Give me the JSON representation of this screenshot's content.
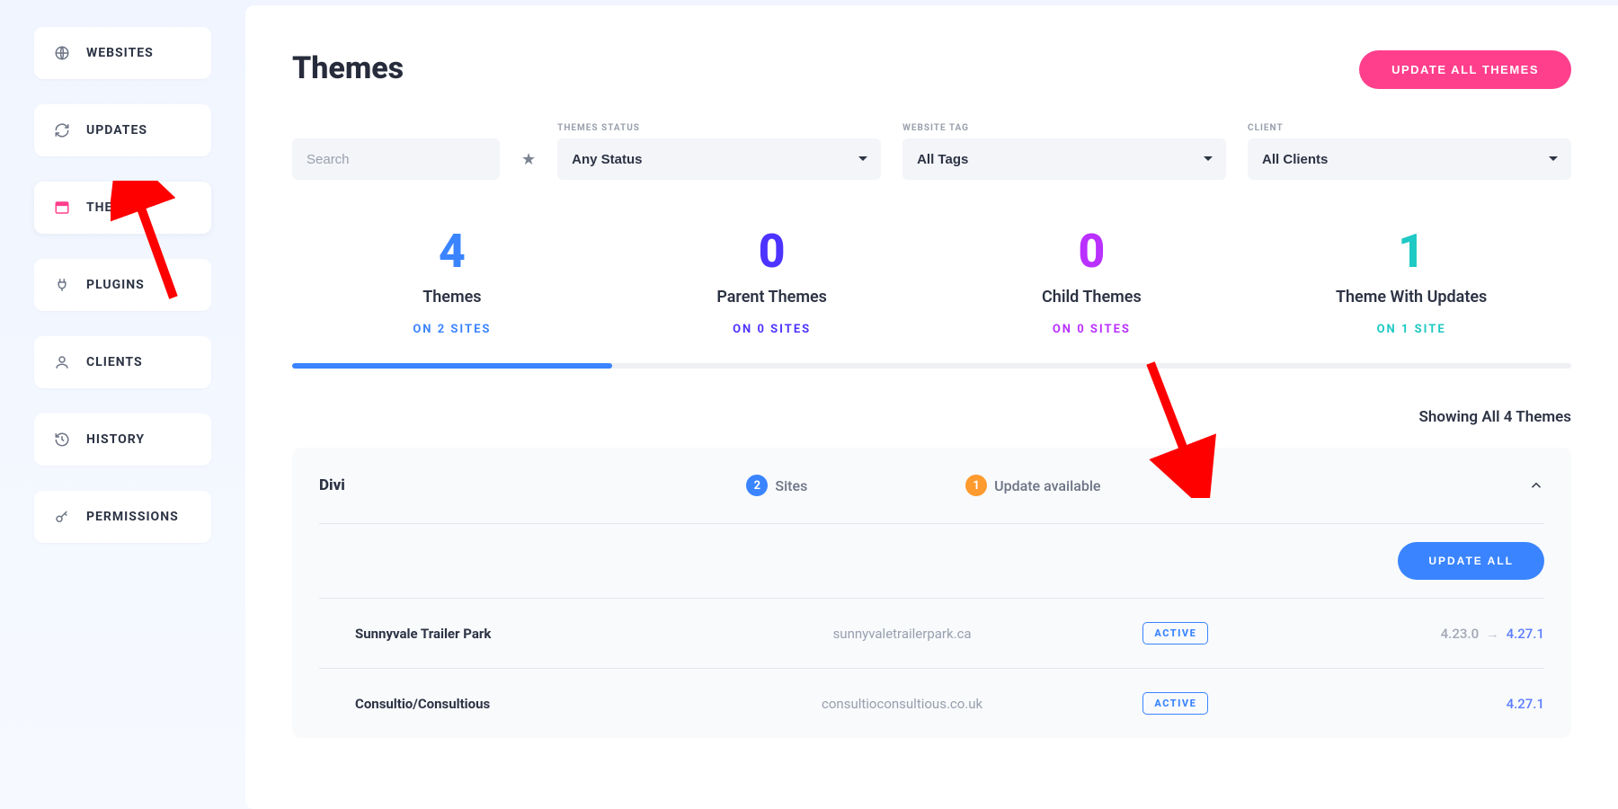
{
  "sidebar": [
    {
      "id": "websites",
      "label": "WEBSITES"
    },
    {
      "id": "updates",
      "label": "UPDATES"
    },
    {
      "id": "themes",
      "label": "THEMES"
    },
    {
      "id": "plugins",
      "label": "PLUGINS"
    },
    {
      "id": "clients",
      "label": "CLIENTS"
    },
    {
      "id": "history",
      "label": "HISTORY"
    },
    {
      "id": "permissions",
      "label": "PERMISSIONS"
    }
  ],
  "page": {
    "title": "Themes",
    "update_all_btn": "UPDATE ALL THEMES"
  },
  "filters": {
    "search_placeholder": "Search",
    "status_label": "THEMES STATUS",
    "status_value": "Any Status",
    "tag_label": "WEBSITE TAG",
    "tag_value": "All Tags",
    "client_label": "CLIENT",
    "client_value": "All Clients"
  },
  "stats": [
    {
      "num": "4",
      "label": "Themes",
      "sub": "ON 2 SITES",
      "klass": "stat-blue"
    },
    {
      "num": "0",
      "label": "Parent Themes",
      "sub": "ON 0 SITES",
      "klass": "stat-indigo"
    },
    {
      "num": "0",
      "label": "Child Themes",
      "sub": "ON 0 SITES",
      "klass": "stat-purple"
    },
    {
      "num": "1",
      "label": "Theme With Updates",
      "sub": "ON 1 SITE",
      "klass": "stat-teal"
    }
  ],
  "summary": "Showing All 4 Themes",
  "card": {
    "theme": "Divi",
    "sites_count": "2",
    "sites_label": "Sites",
    "updates_count": "1",
    "updates_label": "Update available",
    "update_all": "UPDATE ALL",
    "rows": [
      {
        "name": "Sunnyvale Trailer Park",
        "url": "sunnyvaletrailerpark.ca",
        "badge": "ACTIVE",
        "v_old": "4.23.0",
        "v_new": "4.27.1"
      },
      {
        "name": "Consultio/Consultious",
        "url": "consultioconsultious.co.uk",
        "badge": "ACTIVE",
        "v_old": "",
        "v_new": "4.27.1"
      }
    ]
  }
}
